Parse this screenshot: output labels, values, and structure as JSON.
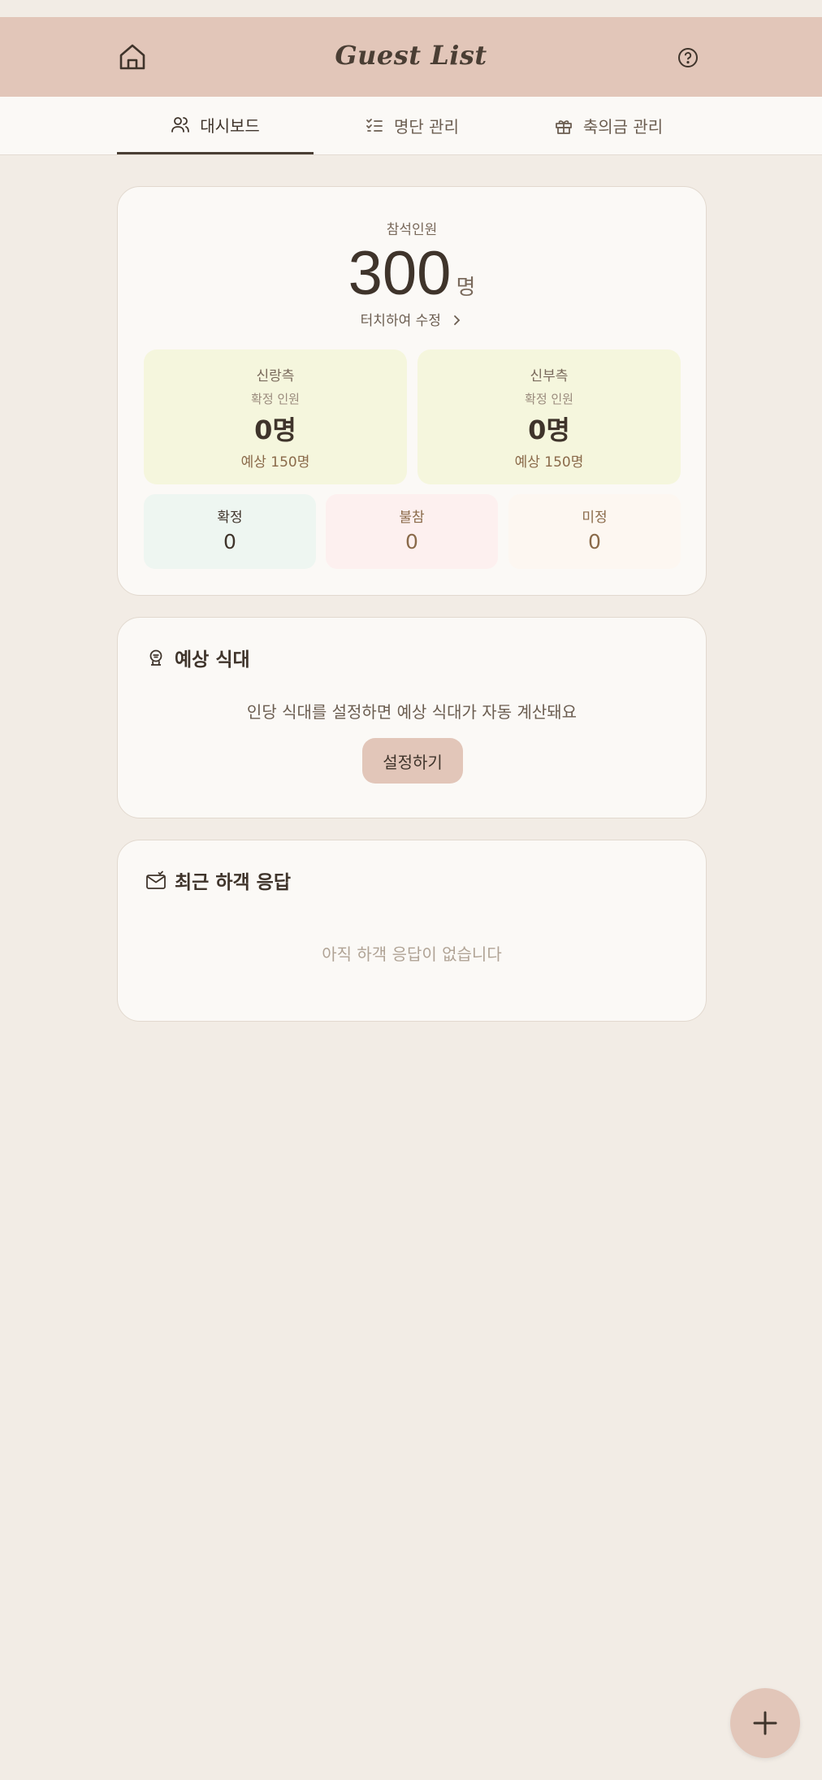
{
  "app": {
    "title": "Guest List"
  },
  "tabs": [
    {
      "label": "대시보드",
      "icon": "users-icon",
      "active": true
    },
    {
      "label": "명단 관리",
      "icon": "checklist-icon",
      "active": false
    },
    {
      "label": "축의금 관리",
      "icon": "gift-icon",
      "active": false
    }
  ],
  "attendance": {
    "label": "참석인원",
    "count": "300",
    "unit": "명",
    "edit_hint": "터치하여 수정",
    "groom": {
      "title": "신랑측",
      "sub": "확정 인원",
      "value": "0명",
      "expected": "예상 150명"
    },
    "bride": {
      "title": "신부측",
      "sub": "확정 인원",
      "value": "0명",
      "expected": "예상 150명"
    },
    "stats": [
      {
        "label": "확정",
        "value": "0",
        "bg": "#eef6f1",
        "color": "#3f342b"
      },
      {
        "label": "불참",
        "value": "0",
        "bg": "#fdf0ef",
        "color": "#8a6a4a"
      },
      {
        "label": "미정",
        "value": "0",
        "bg": "#fdf7f1",
        "color": "#8a6a4a"
      }
    ]
  },
  "meal": {
    "title": "예상 식대",
    "icon": "cloche-icon",
    "description": "인당 식대를 설정하면 예상 식대가 자동 계산돼요",
    "button": "설정하기"
  },
  "recent": {
    "title": "최근 하객 응답",
    "icon": "mail-icon",
    "empty": "아직 하객 응답이 없습니다"
  },
  "colors": {
    "header": "#e2c6b9",
    "background": "#f2ece5",
    "card": "#fbf9f6",
    "text": "#4a3e34",
    "side_bg": "#f5f6dd"
  }
}
